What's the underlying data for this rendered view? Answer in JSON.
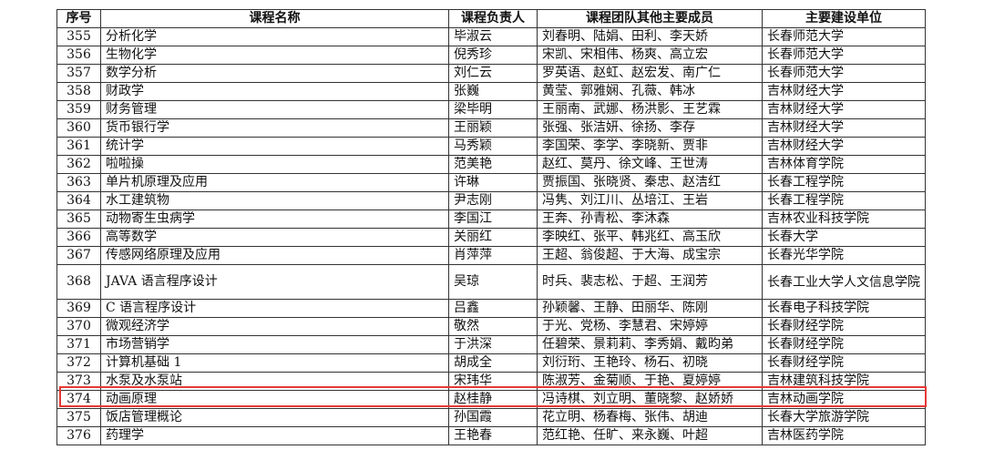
{
  "headers": [
    "序号",
    "课程名称",
    "课程负责人",
    "课程团队其他主要成员",
    "主要建设单位"
  ],
  "rows": [
    {
      "no": "355",
      "course": "分析化学",
      "lead": "毕淑云",
      "team": "刘春明、陆娟、田利、李天娇",
      "unit": "长春师范大学"
    },
    {
      "no": "356",
      "course": "生物化学",
      "lead": "倪秀珍",
      "team": "宋凯、宋相伟、杨爽、高立宏",
      "unit": "长春师范大学"
    },
    {
      "no": "357",
      "course": "数学分析",
      "lead": "刘仁云",
      "team": "罗英语、赵虹、赵宏发、南广仁",
      "unit": "长春师范大学"
    },
    {
      "no": "358",
      "course": "财政学",
      "lead": "张巍",
      "team": "黄莹、郭雅娴、孔薇、韩冰",
      "unit": "吉林财经大学"
    },
    {
      "no": "359",
      "course": "财务管理",
      "lead": "梁毕明",
      "team": "王丽南、武娜、杨洪影、王艺霖",
      "unit": "吉林财经大学"
    },
    {
      "no": "360",
      "course": "货币银行学",
      "lead": "王丽颖",
      "team": "张强、张洁妍、徐扬、李存",
      "unit": "吉林财经大学"
    },
    {
      "no": "361",
      "course": "统计学",
      "lead": "马秀颖",
      "team": "李国荣、李学、李晓新、贾非",
      "unit": "吉林财经大学"
    },
    {
      "no": "362",
      "course": "啦啦操",
      "lead": "范美艳",
      "team": "赵红、莫丹、徐文峰、王世涛",
      "unit": "吉林体育学院"
    },
    {
      "no": "363",
      "course": "单片机原理及应用",
      "lead": "许琳",
      "team": "贾振国、张晓贤、秦忠、赵洁红",
      "unit": "长春工程学院"
    },
    {
      "no": "364",
      "course": "水工建筑物",
      "lead": "尹志刚",
      "team": "冯隽、刘江川、丛培江、王岩",
      "unit": "长春工程学院"
    },
    {
      "no": "365",
      "course": "动物寄生虫病学",
      "lead": "李国江",
      "team": "王奔、孙青松、李沐森",
      "unit": "吉林农业科技学院"
    },
    {
      "no": "366",
      "course": "高等数学",
      "lead": "关丽红",
      "team": "李映红、张平、韩兆红、高玉欣",
      "unit": "长春大学"
    },
    {
      "no": "367",
      "course": "传感网络原理及应用",
      "lead": "肖萍萍",
      "team": "王超、翁俊超、于大海、成宝宗",
      "unit": "长春光华学院"
    },
    {
      "no": "368",
      "course": "JAVA 语言程序设计",
      "lead": "吴琼",
      "team": "时兵、裴志松、于超、王润芳",
      "unit": "长春工业大学人文信息学院"
    },
    {
      "no": "369",
      "course": "C 语言程序设计",
      "lead": "吕鑫",
      "team": "孙颖馨、王静、田丽华、陈刚",
      "unit": "长春电子科技学院"
    },
    {
      "no": "370",
      "course": "微观经济学",
      "lead": "敬然",
      "team": "于光、党杨、李慧君、宋婷婷",
      "unit": "长春财经学院"
    },
    {
      "no": "371",
      "course": "市场营销学",
      "lead": "于洪深",
      "team": "任碧荣、景莉莉、李秀娟、戴昀弟",
      "unit": "长春财经学院"
    },
    {
      "no": "372",
      "course": "计算机基础 1",
      "lead": "胡成全",
      "team": "刘衍珩、王艳玲、杨石、初晓",
      "unit": "长春财经学院"
    },
    {
      "no": "373",
      "course": "水泵及水泵站",
      "lead": "宋玮华",
      "team": "陈淑芳、金菊顺、于艳、夏婷婷",
      "unit": "吉林建筑科技学院"
    },
    {
      "no": "374",
      "course": "动画原理",
      "lead": "赵桂静",
      "team": "冯诗棋、刘立明、董晓黎、赵娇娇",
      "unit": "吉林动画学院"
    },
    {
      "no": "375",
      "course": "饭店管理概论",
      "lead": "孙国霞",
      "team": "花立明、杨春梅、张伟、胡迪",
      "unit": "长春大学旅游学院"
    },
    {
      "no": "376",
      "course": "药理学",
      "lead": "王艳春",
      "team": "范红艳、任旷、来永巍、叶超",
      "unit": "吉林医药学院"
    }
  ],
  "colors": {
    "border": "#333333",
    "highlight": "#e53935"
  }
}
